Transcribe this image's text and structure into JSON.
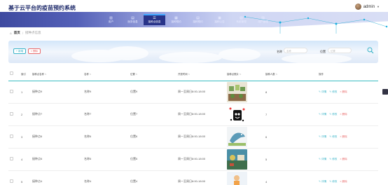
{
  "header": {
    "app_title": "基于云平台的疫苗预约系统",
    "username": "admin",
    "caret": "▼"
  },
  "nav": {
    "items": [
      {
        "label": "用户",
        "icon": "user-icon"
      },
      {
        "label": "医务信息",
        "icon": "medical-icon"
      },
      {
        "label": "接种点信息",
        "icon": "site-icon",
        "active": true
      },
      {
        "label": "接种预约",
        "icon": "calendar-icon"
      },
      {
        "label": "接种预约",
        "icon": "list-icon"
      },
      {
        "label": "接种公告",
        "icon": "notice-icon"
      },
      {
        "label": "系统管理",
        "icon": "system-icon"
      },
      {
        "label": "用户管理",
        "icon": "admin-icon"
      }
    ]
  },
  "breadcrumb": {
    "home": "首页",
    "sep": "/",
    "current": "接种点信息"
  },
  "toolbar": {
    "add_label": "新增",
    "delete_label": "删除",
    "search_name_label": "名称",
    "search_name_placeholder": "名称",
    "search_location_label": "位置",
    "search_location_placeholder": "位置"
  },
  "table": {
    "columns": [
      "索引",
      "接种点名称",
      "名称",
      "位置",
      "开放时间",
      "接种点照片",
      "接种人数",
      "操作"
    ],
    "rows": [
      {
        "index": "1",
        "site": "接种点9",
        "name": "名称9",
        "location": "位置9",
        "hours": "周一至周日8:00-18:00",
        "count": "8",
        "thumb": "thumb-1"
      },
      {
        "index": "2",
        "site": "接种点7",
        "name": "名称7",
        "location": "位置7",
        "hours": "周一至周日8:00-18:00",
        "count": "7",
        "thumb": "thumb-2"
      },
      {
        "index": "3",
        "site": "接种点6",
        "name": "名称6",
        "location": "位置6",
        "hours": "周一至周日8:00-18:00",
        "count": "6",
        "thumb": "thumb-3"
      },
      {
        "index": "4",
        "site": "接种点5",
        "name": "名称5",
        "location": "位置5",
        "hours": "周一至周日8:00-18:00",
        "count": "5",
        "thumb": "thumb-4"
      },
      {
        "index": "5",
        "site": "接种点4",
        "name": "名称4",
        "location": "位置4",
        "hours": "周一至周日8:00-18:00",
        "count": "4",
        "thumb": "thumb-5"
      }
    ],
    "actions": {
      "detail": "详情",
      "edit": "修改",
      "delete": "删除"
    }
  },
  "colors": {
    "nav_dark": "#283389",
    "accent_teal": "#3bb4c8",
    "danger": "#e96b6b"
  }
}
